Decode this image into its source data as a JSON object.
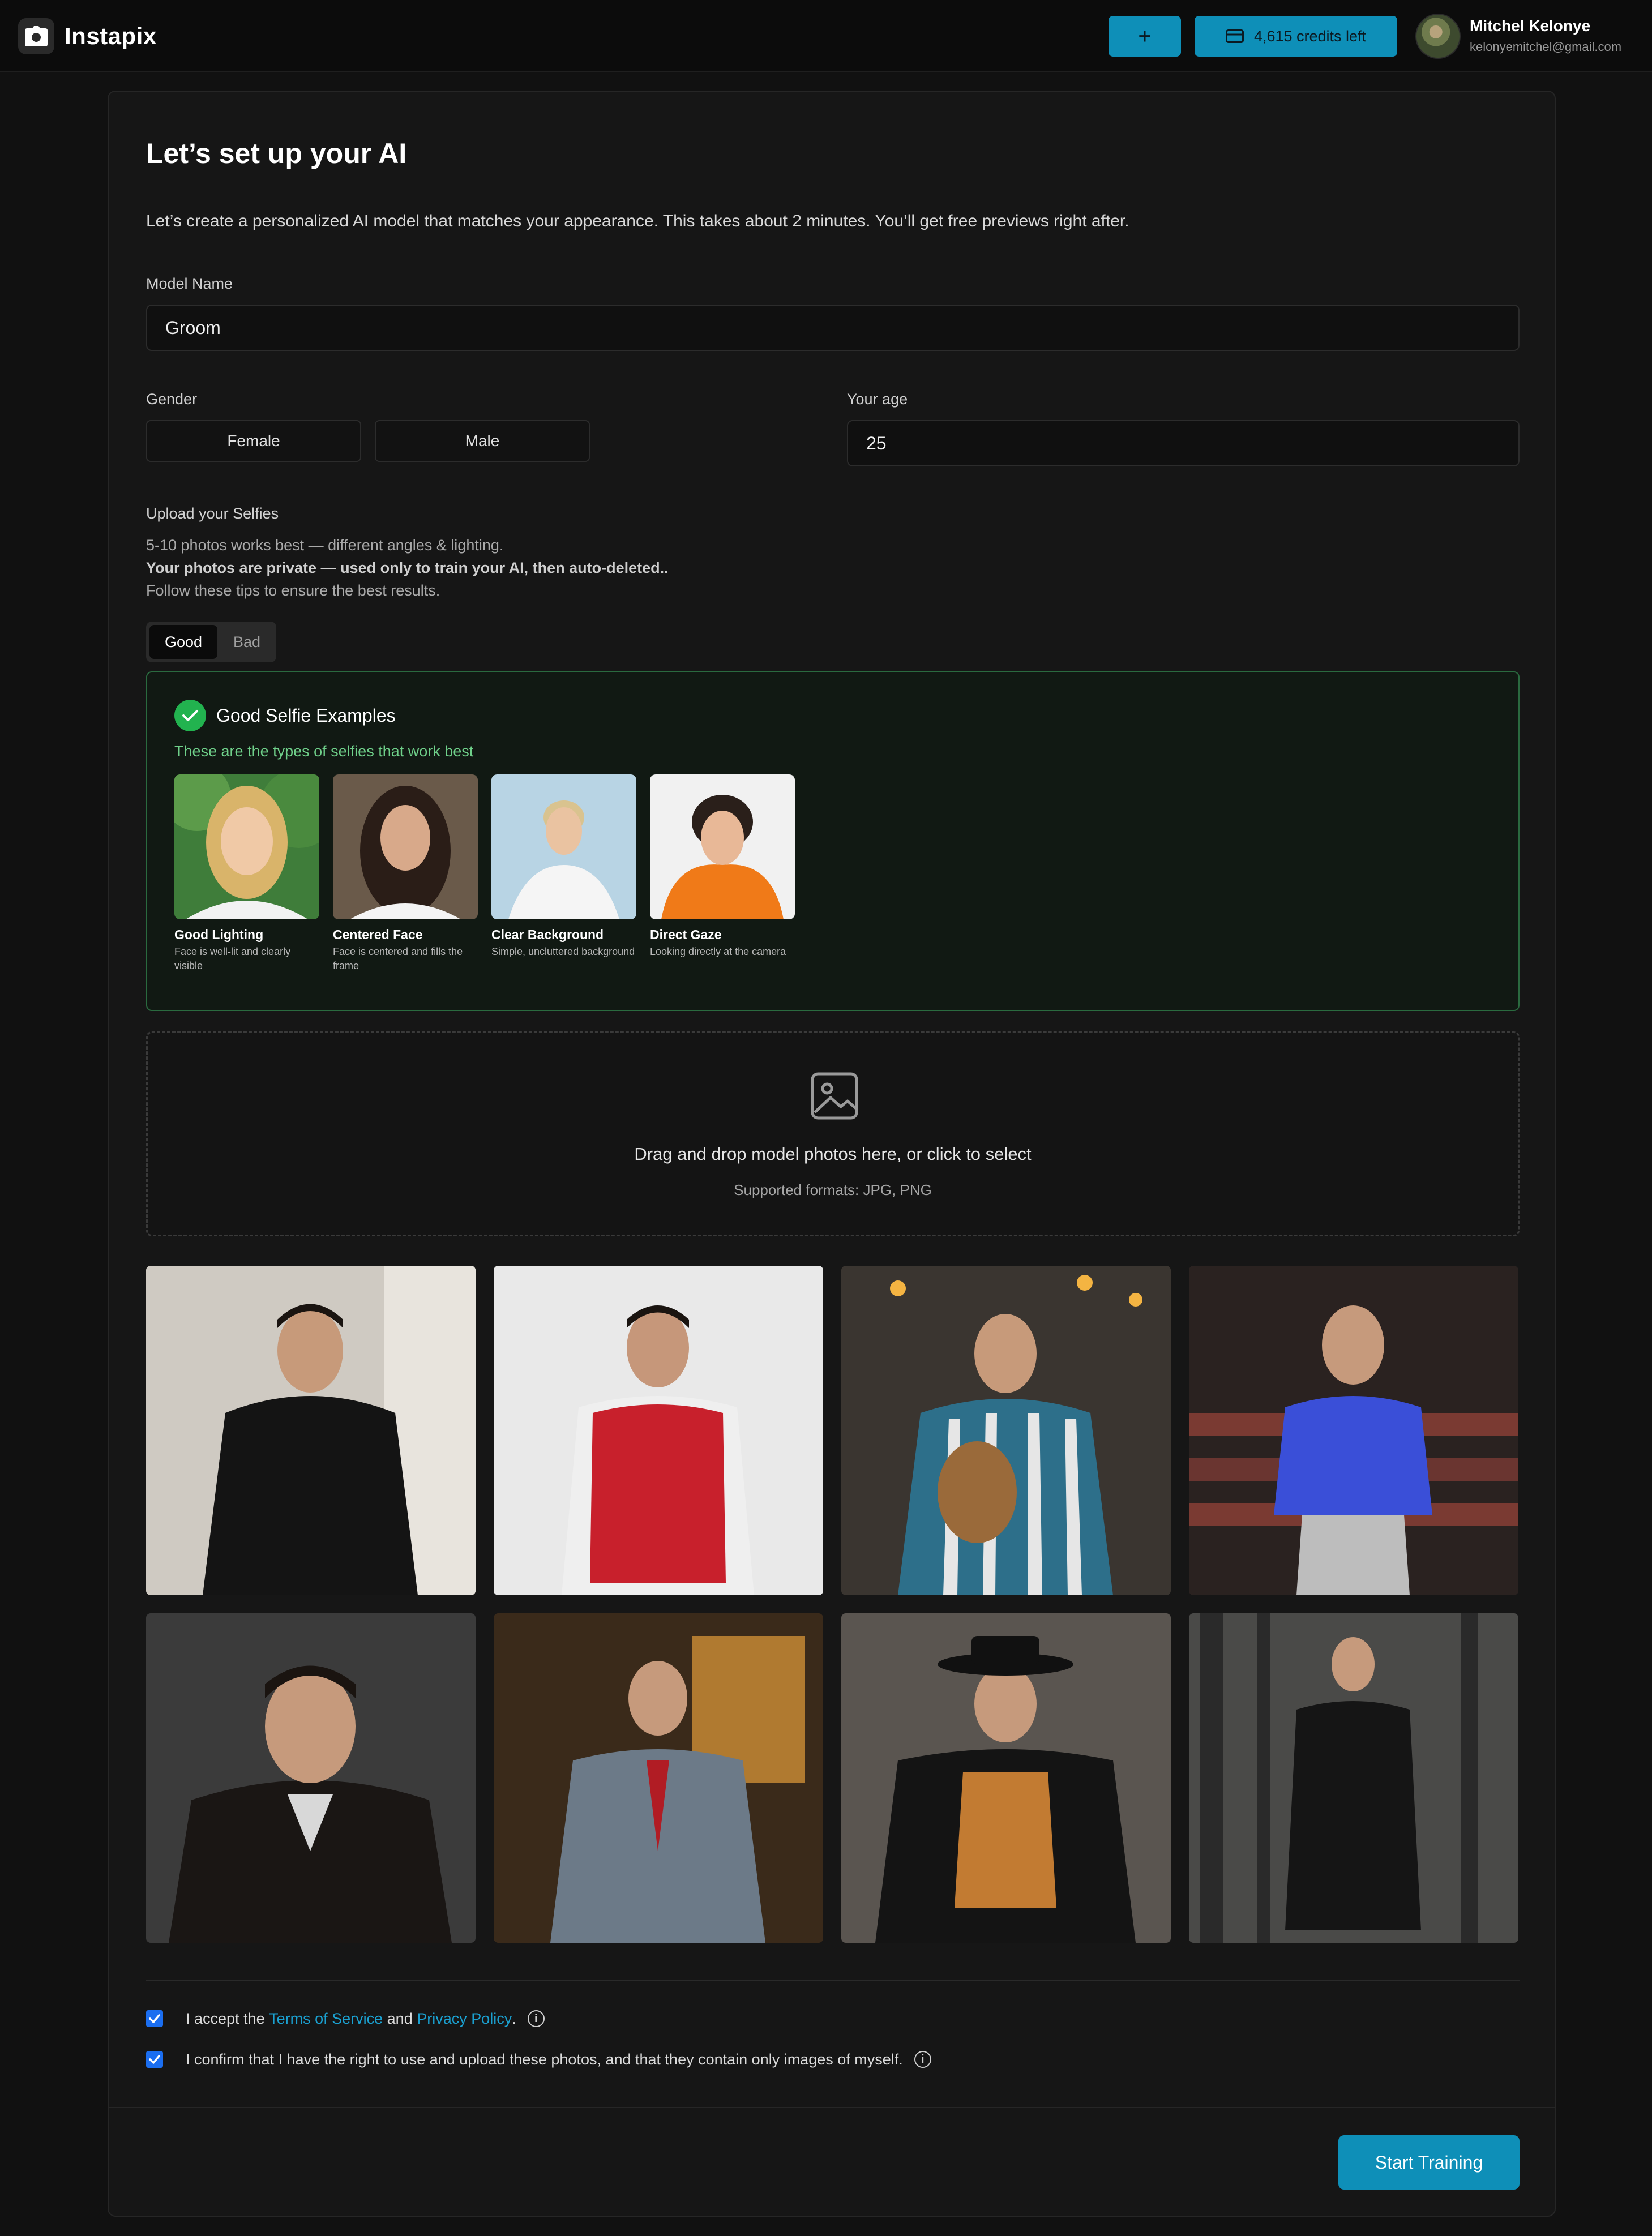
{
  "app": {
    "name": "Instapix"
  },
  "header": {
    "plus_label": "+",
    "credits_label": "4,615 credits left",
    "user_name": "Mitchel Kelonye",
    "user_email": "kelonyemitchel@gmail.com"
  },
  "form": {
    "title": "Let’s set up your AI",
    "subtitle": "Let’s create a personalized AI model that matches your appearance. This takes about 2 minutes. You’ll get free previews right after.",
    "model_name_label": "Model Name",
    "model_name_value": "Groom",
    "gender_label": "Gender",
    "gender_options": [
      "Female",
      "Male"
    ],
    "age_label": "Your age",
    "age_value": "25",
    "upload_label": "Upload your Selfies",
    "upload_hint_1": "5-10 photos works best — different angles & lighting.",
    "upload_hint_2": "Your photos are private — used only to train your AI, then auto-deleted..",
    "upload_hint_3": "Follow these tips to ensure the best results.",
    "tabs": [
      "Good",
      "Bad"
    ],
    "active_tab": "Good"
  },
  "examples": {
    "title": "Good Selfie Examples",
    "subtitle": "These are the types of selfies that work best",
    "items": [
      {
        "label": "Good Lighting",
        "desc": "Face is well-lit and clearly visible"
      },
      {
        "label": "Centered Face",
        "desc": "Face is centered and fills the frame"
      },
      {
        "label": "Clear Background",
        "desc": "Simple, uncluttered background"
      },
      {
        "label": "Direct Gaze",
        "desc": "Looking directly at the camera"
      }
    ]
  },
  "dropzone": {
    "text": "Drag and drop model photos here, or click to select",
    "sub": "Supported formats: JPG, PNG"
  },
  "consent": {
    "terms_prefix": "I accept the ",
    "terms_link": "Terms of Service",
    "terms_and": " and ",
    "privacy_link": "Privacy Policy",
    "terms_suffix": ".",
    "rights_text": "I confirm that I have the right to use and upload these photos, and that they contain only images of myself."
  },
  "actions": {
    "start_label": "Start Training"
  },
  "colors": {
    "accent": "#0e8fb8",
    "success": "#22b34f",
    "checkbox": "#1b6ef0"
  }
}
